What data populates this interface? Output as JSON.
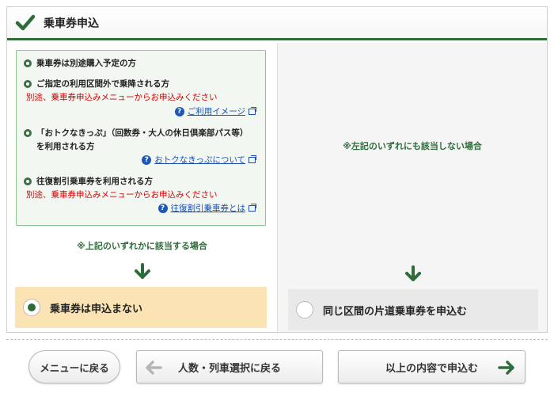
{
  "header": {
    "title": "乗車券申込",
    "icon": "check-icon"
  },
  "left": {
    "items": [
      {
        "title": "乗車券は別途購入予定の方"
      },
      {
        "title": "ご指定の利用区間外で乗降される方",
        "note": "別途、乗車券申込みメニューからお申込みください",
        "link": "ご利用イメージ"
      },
      {
        "title_line1": "「おトクなきっぷ」（回数券・大人の休日倶楽部パス等）",
        "title_line2": "を利用される方",
        "link": "おトクなきっぷについて"
      },
      {
        "title": "往復割引乗車券を利用される方",
        "note": "別途、乗車券申込みメニューからお申込みください",
        "link": "往復割引乗車券とは"
      }
    ],
    "condition": "※上記のいずれかに該当する場合",
    "option": {
      "label": "乗車券は申込まない",
      "selected": true
    }
  },
  "right": {
    "condition": "※左記のいずれにも該当しない場合",
    "option": {
      "label": "同じ区間の片道乗車券を申込む",
      "selected": false
    }
  },
  "footer": {
    "menu_label": "メニューに戻る",
    "back_label": "人数・列車選択に戻る",
    "submit_label": "以上の内容で申込む"
  },
  "colors": {
    "accent": "#2e6d3a",
    "warning": "#d40000",
    "link": "#1a4fb3",
    "selected_bg": "#fbe3b4"
  }
}
